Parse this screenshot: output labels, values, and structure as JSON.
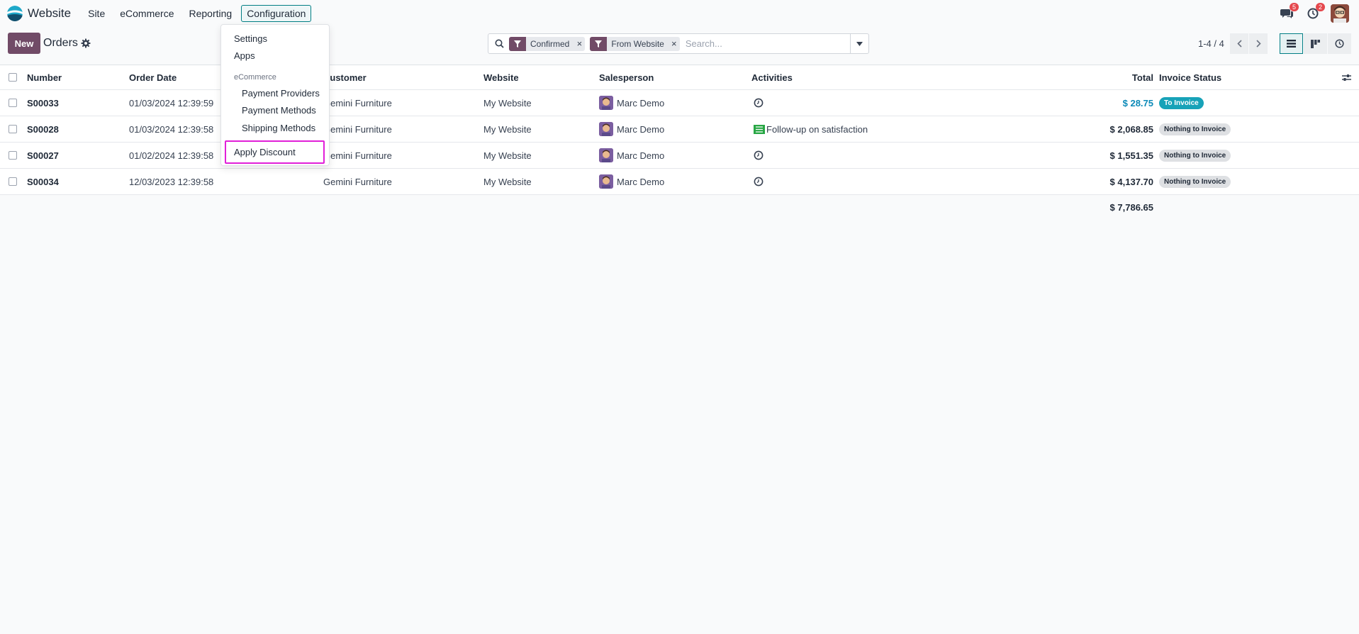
{
  "navbar": {
    "app_name": "Website",
    "menus": [
      "Site",
      "eCommerce",
      "Reporting",
      "Configuration"
    ],
    "messages_count": "5",
    "activities_count": "2"
  },
  "control_panel": {
    "new_label": "New",
    "title": "Orders",
    "facets": [
      "Confirmed",
      "From Website"
    ],
    "search_placeholder": "Search...",
    "pager": "1-4 / 4"
  },
  "dropdown": {
    "items": [
      "Settings",
      "Apps"
    ],
    "section_header": "eCommerce",
    "section_items": [
      "Payment Providers",
      "Payment Methods",
      "Shipping Methods"
    ],
    "highlighted_item": "Apply Discount"
  },
  "table": {
    "columns": [
      "Number",
      "Order Date",
      "Customer",
      "Website",
      "Salesperson",
      "Activities",
      "Total",
      "Invoice Status"
    ],
    "rows": [
      {
        "number": "S00033",
        "date": "01/03/2024 12:39:59",
        "customer": "Gemini Furniture",
        "website": "My Website",
        "salesperson": "Marc Demo",
        "activity": "",
        "total": "$ 28.75",
        "status": "To Invoice"
      },
      {
        "number": "S00028",
        "date": "01/03/2024 12:39:58",
        "customer": "Gemini Furniture",
        "website": "My Website",
        "salesperson": "Marc Demo",
        "activity": "Follow-up on satisfaction",
        "total": "$ 2,068.85",
        "status": "Nothing to Invoice"
      },
      {
        "number": "S00027",
        "date": "01/02/2024 12:39:58",
        "customer": "Gemini Furniture",
        "website": "My Website",
        "salesperson": "Marc Demo",
        "activity": "",
        "total": "$ 1,551.35",
        "status": "Nothing to Invoice"
      },
      {
        "number": "S00034",
        "date": "12/03/2023 12:39:58",
        "customer": "Gemini Furniture",
        "website": "My Website",
        "salesperson": "Marc Demo",
        "activity": "",
        "total": "$ 4,137.70",
        "status": "Nothing to Invoice"
      }
    ],
    "grand_total": "$ 7,786.65"
  },
  "colors": {
    "brand": "#714b67",
    "accent": "#017e84",
    "highlight": "#e11fd8",
    "link_total": "#0b8ab8"
  }
}
